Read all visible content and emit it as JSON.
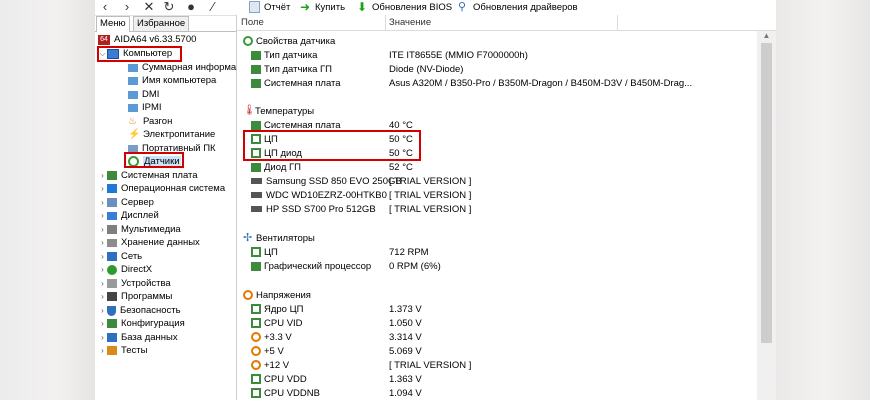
{
  "toolbar": {
    "report_label": "Отчёт",
    "buy_label": "Купить",
    "bios_label": "Обновления BIOS",
    "drivers_label": "Обновления драйверов"
  },
  "tabs": {
    "menu": "Меню",
    "favorites": "Избранное"
  },
  "tree": {
    "app": "AIDA64 v6.33.5700",
    "computer": "Компьютер",
    "computer_children": [
      "Суммарная информа",
      "Имя компьютера",
      "DMI",
      "IPMI",
      "Разгон",
      "Электропитание",
      "Портативный ПК",
      "Датчики"
    ],
    "top_items": [
      "Системная плата",
      "Операционная система",
      "Сервер",
      "Дисплей",
      "Мультимедиа",
      "Хранение данных",
      "Сеть",
      "DirectX",
      "Устройства",
      "Программы",
      "Безопасность",
      "Конфигурация",
      "База данных",
      "Тесты"
    ]
  },
  "columns": {
    "field": "Поле",
    "value": "Значение"
  },
  "sections": {
    "sensor_props": {
      "title": "Свойства датчика",
      "rows": [
        {
          "field": "Тип датчика",
          "value": "ITE IT8655E  (MMIO F7000000h)"
        },
        {
          "field": "Тип датчика ГП",
          "value": "Diode  (NV-Diode)"
        },
        {
          "field": "Системная плата",
          "value": "Asus A320M / B350-Pro / B350M-Dragon / B450M-D3V / B450M-Drag..."
        }
      ]
    },
    "temps": {
      "title": "Температуры",
      "rows": [
        {
          "field": "Системная плата",
          "value": "40 °C"
        },
        {
          "field": "ЦП",
          "value": "50 °C"
        },
        {
          "field": "ЦП диод",
          "value": "50 °C"
        },
        {
          "field": "Диод ГП",
          "value": "52 °C"
        },
        {
          "field": "Samsung SSD 850 EVO 250GB",
          "value": "[ TRIAL VERSION ]"
        },
        {
          "field": "WDC WD10EZRZ-00HTKB0",
          "value": "[ TRIAL VERSION ]"
        },
        {
          "field": "HP SSD S700 Pro 512GB",
          "value": "[ TRIAL VERSION ]"
        }
      ]
    },
    "fans": {
      "title": "Вентиляторы",
      "rows": [
        {
          "field": "ЦП",
          "value": "712 RPM"
        },
        {
          "field": "Графический процессор",
          "value": "0 RPM  (6%)"
        }
      ]
    },
    "volts": {
      "title": "Напряжения",
      "rows": [
        {
          "field": "Ядро ЦП",
          "value": "1.373 V"
        },
        {
          "field": "CPU VID",
          "value": "1.050 V"
        },
        {
          "field": "+3.3 V",
          "value": "3.314 V"
        },
        {
          "field": "+5 V",
          "value": "5.069 V"
        },
        {
          "field": "+12 V",
          "value": "[ TRIAL VERSION ]"
        },
        {
          "field": "CPU VDD",
          "value": "1.363 V"
        },
        {
          "field": "CPU VDDNB",
          "value": "1.094 V"
        }
      ]
    }
  },
  "colors": {
    "highlight": "#d40000",
    "selection": "#cce4f7"
  }
}
